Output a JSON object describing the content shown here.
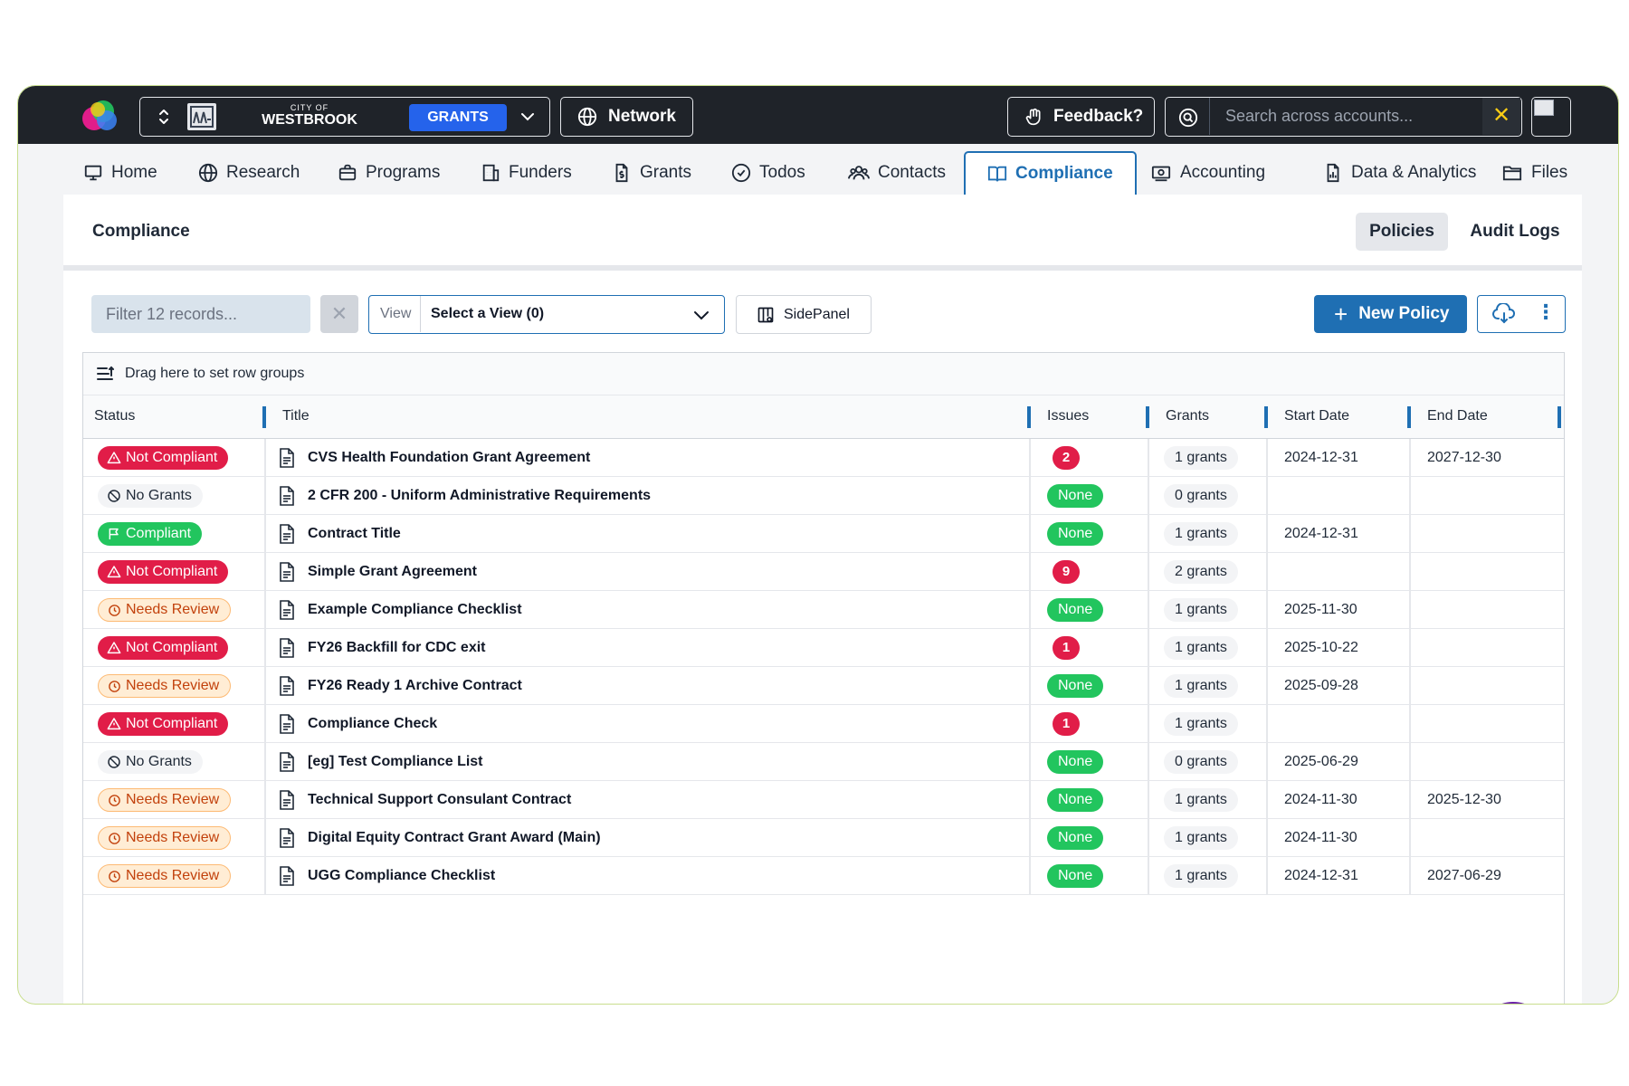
{
  "topbar": {
    "city_small": "CITY OF",
    "city_name": "WESTBROOK",
    "product_badge": "GRANTS",
    "network_label": "Network",
    "feedback_label": "Feedback?",
    "search_placeholder": "Search across accounts...",
    "search_clear": "✕"
  },
  "nav": {
    "items": [
      {
        "label": "Home",
        "icon": "monitor-icon"
      },
      {
        "label": "Research",
        "icon": "globe-icon"
      },
      {
        "label": "Programs",
        "icon": "briefcase-icon"
      },
      {
        "label": "Funders",
        "icon": "building-icon"
      },
      {
        "label": "Grants",
        "icon": "dollar-file-icon"
      },
      {
        "label": "Todos",
        "icon": "check-circle-icon"
      },
      {
        "label": "Contacts",
        "icon": "users-icon"
      },
      {
        "label": "Compliance",
        "icon": "book-icon",
        "active": true
      },
      {
        "label": "Accounting",
        "icon": "cash-icon"
      },
      {
        "label": "Data & Analytics",
        "icon": "chart-file-icon"
      },
      {
        "label": "Files",
        "icon": "folder-icon"
      }
    ]
  },
  "page": {
    "title": "Compliance",
    "tabs": [
      "Policies",
      "Audit Logs"
    ],
    "active_tab": "Policies"
  },
  "toolbar": {
    "filter_placeholder": "Filter 12 records...",
    "clear_label": "✕",
    "view_label": "View",
    "view_value": "Select a View (0)",
    "sidepanel_label": "SidePanel",
    "new_policy_label": "New Policy",
    "plus": "+",
    "kebab": "⋮"
  },
  "grid": {
    "group_hint": "Drag here to set row groups",
    "columns": [
      "Status",
      "Title",
      "Issues",
      "Grants",
      "Start Date",
      "End Date"
    ],
    "rows": [
      {
        "status": "Not Compliant",
        "status_kind": "notcompliant",
        "title": "CVS Health Foundation Grant Agreement",
        "issues": "2",
        "grants": "1 grants",
        "start": "2024-12-31",
        "end": "2027-12-30"
      },
      {
        "status": "No Grants",
        "status_kind": "nogrants",
        "title": "2 CFR 200 - Uniform Administrative Requirements",
        "issues": "None",
        "grants": "0 grants",
        "start": "",
        "end": ""
      },
      {
        "status": "Compliant",
        "status_kind": "compliant",
        "title": "Contract Title",
        "issues": "None",
        "grants": "1 grants",
        "start": "2024-12-31",
        "end": ""
      },
      {
        "status": "Not Compliant",
        "status_kind": "notcompliant",
        "title": "Simple Grant Agreement",
        "issues": "9",
        "grants": "2 grants",
        "start": "",
        "end": ""
      },
      {
        "status": "Needs Review",
        "status_kind": "needsreview",
        "title": "Example Compliance Checklist",
        "issues": "None",
        "grants": "1 grants",
        "start": "2025-11-30",
        "end": ""
      },
      {
        "status": "Not Compliant",
        "status_kind": "notcompliant",
        "title": "FY26 Backfill for CDC exit",
        "issues": "1",
        "grants": "1 grants",
        "start": "2025-10-22",
        "end": ""
      },
      {
        "status": "Needs Review",
        "status_kind": "needsreview",
        "title": "FY26 Ready 1 Archive Contract",
        "issues": "None",
        "grants": "1 grants",
        "start": "2025-09-28",
        "end": ""
      },
      {
        "status": "Not Compliant",
        "status_kind": "notcompliant",
        "title": "Compliance Check",
        "issues": "1",
        "grants": "1 grants",
        "start": "",
        "end": ""
      },
      {
        "status": "No Grants",
        "status_kind": "nogrants",
        "title": "[eg] Test Compliance List",
        "issues": "None",
        "grants": "0 grants",
        "start": "2025-06-29",
        "end": ""
      },
      {
        "status": "Needs Review",
        "status_kind": "needsreview",
        "title": "Technical Support Consulant Contract",
        "issues": "None",
        "grants": "1 grants",
        "start": "2024-11-30",
        "end": "2025-12-30"
      },
      {
        "status": "Needs Review",
        "status_kind": "needsreview",
        "title": "Digital Equity Contract Grant Award (Main)",
        "issues": "None",
        "grants": "1 grants",
        "start": "2024-11-30",
        "end": ""
      },
      {
        "status": "Needs Review",
        "status_kind": "needsreview",
        "title": "UGG Compliance Checklist",
        "issues": "None",
        "grants": "1 grants",
        "start": "2024-12-31",
        "end": "2027-06-29"
      }
    ]
  },
  "colors": {
    "accent": "#1f6fb3",
    "danger": "#e11d48",
    "success": "#22c55e",
    "warning_bg": "#ffedd5",
    "warning_text": "#c2410c",
    "topbar_bg": "#1f2329"
  }
}
